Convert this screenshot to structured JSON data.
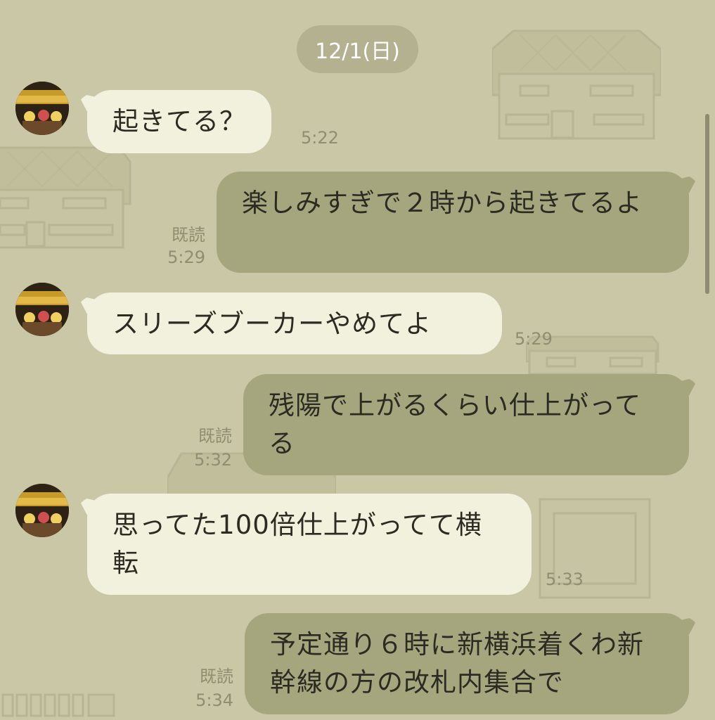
{
  "date_label": "12/1(日)",
  "messages": [
    {
      "direction": "in",
      "text": "起きてる？",
      "time": "5:22"
    },
    {
      "direction": "out",
      "text": "楽しみすぎで２時から起きてるよ",
      "read": "既読",
      "time": "5:29"
    },
    {
      "direction": "in",
      "text": "スリーズブーカーやめてよ",
      "time": "5:29"
    },
    {
      "direction": "out",
      "text": "残陽で上がるくらい仕上がってる",
      "read": "既読",
      "time": "5:32"
    },
    {
      "direction": "in",
      "text": "思ってた100倍仕上がってて横転",
      "time": "5:33"
    },
    {
      "direction": "out",
      "text": "予定通り６時に新横浜着くわ新幹線の方の改札内集合で",
      "read": "既読",
      "time": "5:34"
    }
  ],
  "colors": {
    "background": "#c9c7a5",
    "incoming_bubble": "#f2f1dd",
    "outgoing_bubble": "#a6a67e",
    "meta_text": "#8f8d72"
  },
  "icons": {
    "avatar": "avatar-photo"
  }
}
